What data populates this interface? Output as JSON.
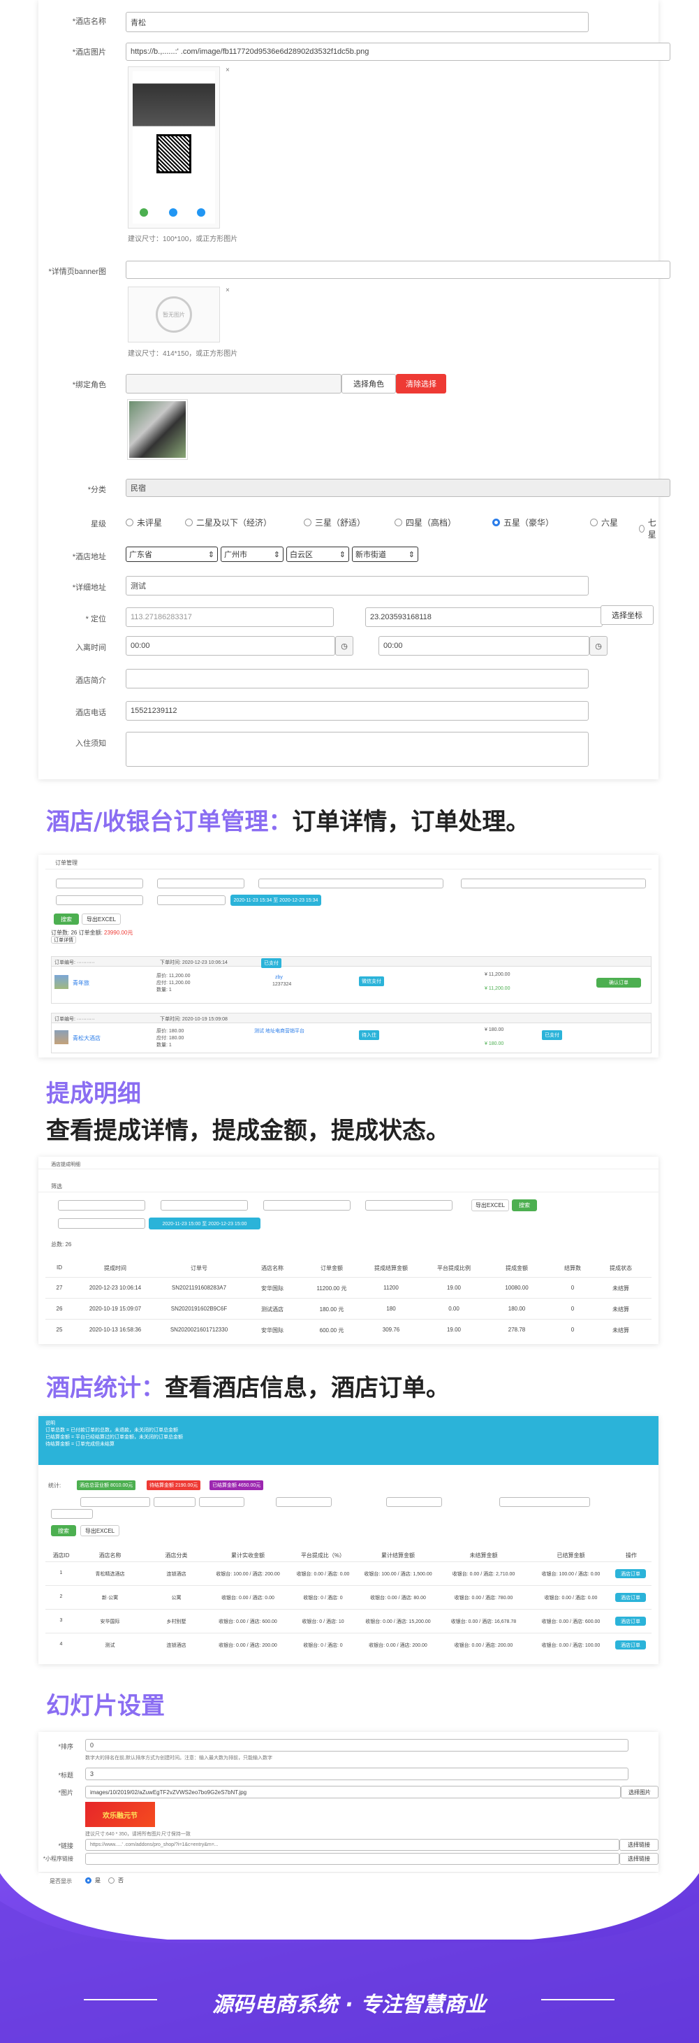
{
  "hotel_form": {
    "name_label": "*酒店名称",
    "name_value": "青松",
    "image_label": "*酒店图片",
    "image_url": "https://b.,......:' .com/image/fb117720d9536e6d28902d3532f1dc5b.png",
    "image_hint": "建议尺寸：100*100，或正方形图片",
    "banner_label": "*详情页banner图",
    "banner_placeholder_text": "暂无图片",
    "banner_hint": "建议尺寸：414*150，或正方形图片",
    "role_label": "*绑定角色",
    "select_role_button": "选择角色",
    "clear_button": "清除选择",
    "category_label": "*分类",
    "category_value": "民宿",
    "star_label": "星级",
    "star_options": [
      "未评星",
      "二星及以下（经济）",
      "三星（舒适）",
      "四星（高档）",
      "五星（豪华）",
      "六星",
      "七星"
    ],
    "star_selected": "五星（豪华）",
    "address_label": "*酒店地址",
    "province": "广东省",
    "city": "广州市",
    "district": "白云区",
    "street": "新市街道",
    "detail_address_label": "*详细地址",
    "detail_address_value": "测试",
    "location_label": "* 定位",
    "lng": "113.27186283317",
    "lat": "23.203593168118",
    "pick_coord_button": "选择坐标",
    "checkin_label": "入离时间",
    "time_from": "00:00",
    "time_to": "00:00",
    "intro_label": "酒店简介",
    "phone_label": "酒店电话",
    "phone_value": "15521239112",
    "notice_label": "入住须知"
  },
  "section_orders": {
    "heading_highlight": "酒店/收银台订单管理：",
    "heading_rest": "订单详情，订单处理。",
    "title": "订单管理",
    "date_range": "2020-11-23 15:34 至 2020-12-23 15:34",
    "search_button": "搜索",
    "export_button": "导出EXCEL",
    "summary_prefix": "订单数: 26 订单金额:",
    "summary_amount": "23990.00元",
    "order_detail_btn": "订单详情",
    "orders": [
      {
        "no_label": "订单编号: ···········",
        "time": "下单时间: 2020-12-23 10:06:14",
        "status": "已支付",
        "name": "青年旅",
        "price": "原价: 11,200.00",
        "paid": "应付: 11,200.00",
        "qty": "数量: 1",
        "user": "zby",
        "phone": "1237324",
        "pay": "微信支付",
        "subtotal": "¥ 11,200.00",
        "total": "¥ 11,200.00",
        "action": "确认订单"
      },
      {
        "no_label": "订单编号: ···········",
        "time": "下单时间: 2020-10-19 15:09:08",
        "status": "待入住",
        "name": "青松大酒店",
        "price": "原价: 180.00",
        "paid": "应付: 180.00",
        "qty": "数量: 1",
        "user": "测试 地址电商营销平台",
        "phone": "1237324",
        "pay": "已支付",
        "subtotal": "¥ 180.00",
        "total": "¥ 180.00",
        "action": ""
      }
    ]
  },
  "section_commission": {
    "heading": "提成明细",
    "subheading": "查看提成详情，提成金额，提成状态。",
    "title": "酒店提成明细",
    "filter_label": "筛选",
    "date_range": "2020-11-23 15:00 至 2020-12-23 15:00",
    "export_button": "导出EXCEL",
    "search_button": "搜索",
    "total_label": "总数: 26",
    "columns": [
      "ID",
      "提成时间",
      "订单号",
      "酒店名称",
      "订单金额",
      "提成结算金额",
      "平台提成比例",
      "提成金额",
      "结算数",
      "提成状态"
    ],
    "rows": [
      [
        "27",
        "2020-12-23 10:06:14",
        "SN2021191608283A7",
        "安华国际",
        "11200.00 元",
        "11200",
        "19.00",
        "10080.00",
        "0",
        "未结算"
      ],
      [
        "26",
        "2020-10-19 15:09:07",
        "SN2020191602B9C6F",
        "测试酒店",
        "180.00 元",
        "180",
        "0.00",
        "180.00",
        "0",
        "未结算"
      ],
      [
        "25",
        "2020-10-13 16:58:36",
        "SN2020021601712330",
        "安华国际",
        "600.00 元",
        "309.76",
        "19.00",
        "278.78",
        "0",
        "未结算"
      ]
    ]
  },
  "section_stats": {
    "heading_highlight": "酒店统计：",
    "heading_rest": "查看酒店信息，酒店订单。",
    "notice_lines": [
      "说明",
      "订单总数 = 已付款订单的总数，未退款，未关闭的订单总金额",
      "已结算金额 = 平台已经结算过的订单金额，未关闭的订单总金额",
      "待结算金额 = 订单完成但未结算"
    ],
    "stat_label": "统计:",
    "badges": [
      "酒店总营业额 8010.00元",
      "待结算金额 2190.00元",
      "已结算金额 4650.00元"
    ],
    "search_button": "搜索",
    "export_button": "导出EXCEL",
    "columns": [
      "酒店ID",
      "酒店名称",
      "酒店分类",
      "累计实收金额",
      "平台提成比（%）",
      "累计结算金额",
      "未结算金额",
      "已结算金额",
      "操作"
    ],
    "rows": [
      [
        "1",
        "青松精选酒店",
        "连锁酒店",
        "收银台: 100.00 / 酒店: 200.00",
        "收银台: 0.00 / 酒店: 0.00",
        "收银台: 100.00 / 酒店: 1,500.00",
        "收银台: 0.00 / 酒店: 2,710.00",
        "收银台: 100.00 / 酒店: 0.00",
        "酒店订单"
      ],
      [
        "2",
        "新·公寓",
        "公寓",
        "收银台: 0.00 / 酒店: 0.00",
        "收银台: 0 / 酒店: 0",
        "收银台: 0.00 / 酒店: 80.00",
        "收银台: 0.00 / 酒店: 780.00",
        "收银台: 0.00 / 酒店: 0.00",
        "酒店订单"
      ],
      [
        "3",
        "安华国际",
        "乡村别墅",
        "收银台: 0.00 / 酒店: 600.00",
        "收银台: 0 / 酒店: 10",
        "收银台: 0.00 / 酒店: 15,200.00",
        "收银台: 0.00 / 酒店: 16,678.78",
        "收银台: 0.00 / 酒店: 600.00",
        "酒店订单"
      ],
      [
        "4",
        "测试",
        "连锁酒店",
        "收银台: 0.00 / 酒店: 200.00",
        "收银台: 0 / 酒店: 0",
        "收银台: 0.00 / 酒店: 200.00",
        "收银台: 0.00 / 酒店: 200.00",
        "收银台: 0.00 / 酒店: 100.00",
        "酒店订单"
      ]
    ]
  },
  "section_slides": {
    "heading": "幻灯片设置",
    "sort_label": "*排序",
    "sort_value": "0",
    "sort_hint": "数字大的排名在前,默认排序方式为创建时间。注意：输入最大数为排前，只能输入数字",
    "title_label": "*标题",
    "title_value": "3",
    "image_label": "*图片",
    "image_value": "images/10/2019/02/aZuwEgTF2vZVWS2eo7bo9G2eS7bNT.jpg",
    "upload_button": "选择图片",
    "image_hint": "建议尺寸:640 * 350，请将所有图片尺寸保持一致",
    "banner_text": "欢乐融元节",
    "link_label": "*链接",
    "link_value": "https://www.....' .com/addons/pro_shop/?i=1&c=entry&m=...",
    "link_button": "选择链接",
    "mini_link_label": "*小程序链接",
    "mini_link_button": "选择链接",
    "show_label": "是否显示",
    "show_yes": "是",
    "show_no": "否"
  },
  "footer": {
    "slogan": "源码电商系统 · 专注智慧商业"
  },
  "colors": {
    "accent_purple": "#8a6df2",
    "red": "#ee3a34",
    "green": "#4caf50",
    "blue": "#2bb3d9",
    "footer_bg": "#6b3fe0"
  }
}
